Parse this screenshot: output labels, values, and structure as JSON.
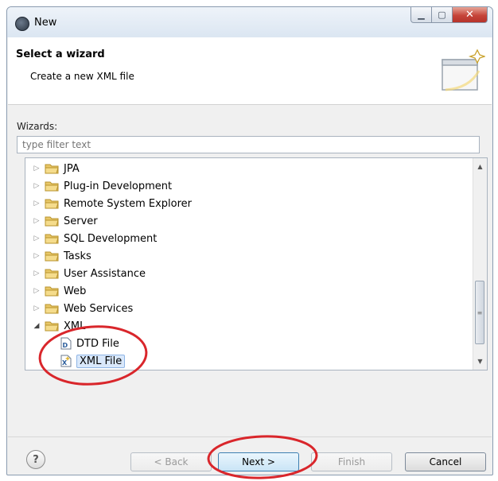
{
  "window": {
    "title": "New"
  },
  "header": {
    "title": "Select a wizard",
    "description": "Create a new XML file"
  },
  "wizards_label": "Wizards:",
  "filter": {
    "placeholder": "type filter text",
    "value": ""
  },
  "tree": {
    "items": [
      {
        "label": "JPA",
        "expanded": false
      },
      {
        "label": "Plug-in Development",
        "expanded": false
      },
      {
        "label": "Remote System Explorer",
        "expanded": false
      },
      {
        "label": "Server",
        "expanded": false
      },
      {
        "label": "SQL Development",
        "expanded": false
      },
      {
        "label": "Tasks",
        "expanded": false
      },
      {
        "label": "User Assistance",
        "expanded": false
      },
      {
        "label": "Web",
        "expanded": false
      },
      {
        "label": "Web Services",
        "expanded": false
      },
      {
        "label": "XML",
        "expanded": true
      }
    ],
    "children": [
      {
        "label": "DTD File"
      },
      {
        "label": "XML File",
        "selected": true
      }
    ]
  },
  "buttons": {
    "back": "< Back",
    "next": "Next >",
    "finish": "Finish",
    "cancel": "Cancel"
  },
  "help_symbol": "?",
  "colors": {
    "accent_selection": "#d9e8fb",
    "folder": "#e8c767",
    "annotation": "#d9262b"
  }
}
